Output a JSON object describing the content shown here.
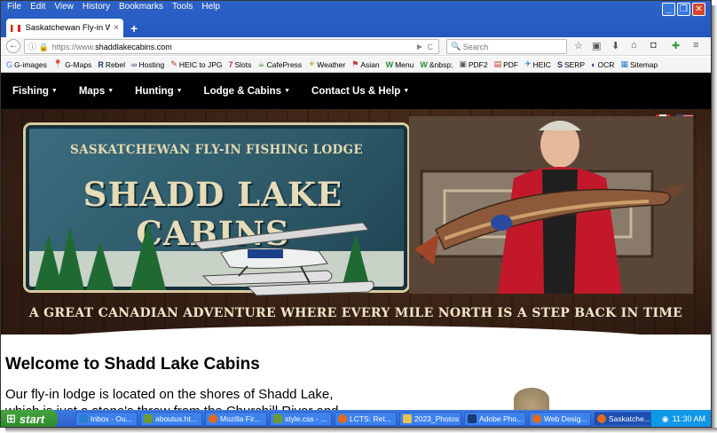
{
  "menu": [
    "File",
    "Edit",
    "View",
    "History",
    "Bookmarks",
    "Tools",
    "Help"
  ],
  "window_buttons": {
    "minimize": "_",
    "maximize": "❐",
    "close": "✕"
  },
  "tab": {
    "title": "Saskatchewan Fly-in Wa...",
    "close": "×",
    "new": "+"
  },
  "address": {
    "prefix": "https://www.",
    "host": "shaddlakecabins.com",
    "reload": "C"
  },
  "search": {
    "placeholder": "Search"
  },
  "bookmarks": [
    {
      "label": "G-images",
      "icon": "G"
    },
    {
      "label": "G-Maps",
      "icon": "📍"
    },
    {
      "label": "Rebel",
      "icon": "R"
    },
    {
      "label": "Hosting",
      "icon": "∞"
    },
    {
      "label": "HEIC to JPG",
      "icon": "✎"
    },
    {
      "label": "Slots",
      "icon": "7"
    },
    {
      "label": "CafePress",
      "icon": "☕"
    },
    {
      "label": "Weather",
      "icon": "☀"
    },
    {
      "label": "Asian",
      "icon": "⚑"
    },
    {
      "label": "Menu",
      "icon": "W"
    },
    {
      "label": "&nbsp;",
      "icon": "W"
    },
    {
      "label": "PDF2",
      "icon": "▣"
    },
    {
      "label": "PDF",
      "icon": "▤"
    },
    {
      "label": "HEIC",
      "icon": "✈"
    },
    {
      "label": "SERP",
      "icon": "S"
    },
    {
      "label": "OCR",
      "icon": "◐"
    },
    {
      "label": "Sitemap",
      "icon": "▦"
    }
  ],
  "sitenav": [
    {
      "label": "Fishing"
    },
    {
      "label": "Maps"
    },
    {
      "label": "Hunting"
    },
    {
      "label": "Lodge & Cabins"
    },
    {
      "label": "Contact Us & Help"
    }
  ],
  "banner": {
    "sign_top": "SASKATCHEWAN FLY-IN FISHING LODGE",
    "sign_main": "SHADD LAKE CABINS",
    "tagline": "A GREAT CANADIAN ADVENTURE WHERE EVERY MILE NORTH IS A STEP BACK IN TIME"
  },
  "content": {
    "heading": "Welcome to Shadd Lake Cabins",
    "paragraph": "Our fly-in lodge is located on the shores of Shadd Lake, which is just a stone's throw from the Churchill River and"
  },
  "taskbar": {
    "start": "start",
    "tasks": [
      {
        "label": "Inbox - Ou...",
        "color": "#2c7fd0"
      },
      {
        "label": "aboutus.ht...",
        "color": "#6a9a34"
      },
      {
        "label": "Mozilla Fir...",
        "color": "#e36a1a"
      },
      {
        "label": "style.css - ...",
        "color": "#6a9a34"
      },
      {
        "label": "LCTS: Ret...",
        "color": "#e36a1a"
      },
      {
        "label": "2023_Photos",
        "color": "#e7c44d"
      },
      {
        "label": "Adobe Pho...",
        "color": "#1b3a7a"
      },
      {
        "label": "Web Desig...",
        "color": "#e36a1a"
      },
      {
        "label": "Saskatche...",
        "color": "#e36a1a"
      }
    ],
    "time": "11:30 AM"
  }
}
